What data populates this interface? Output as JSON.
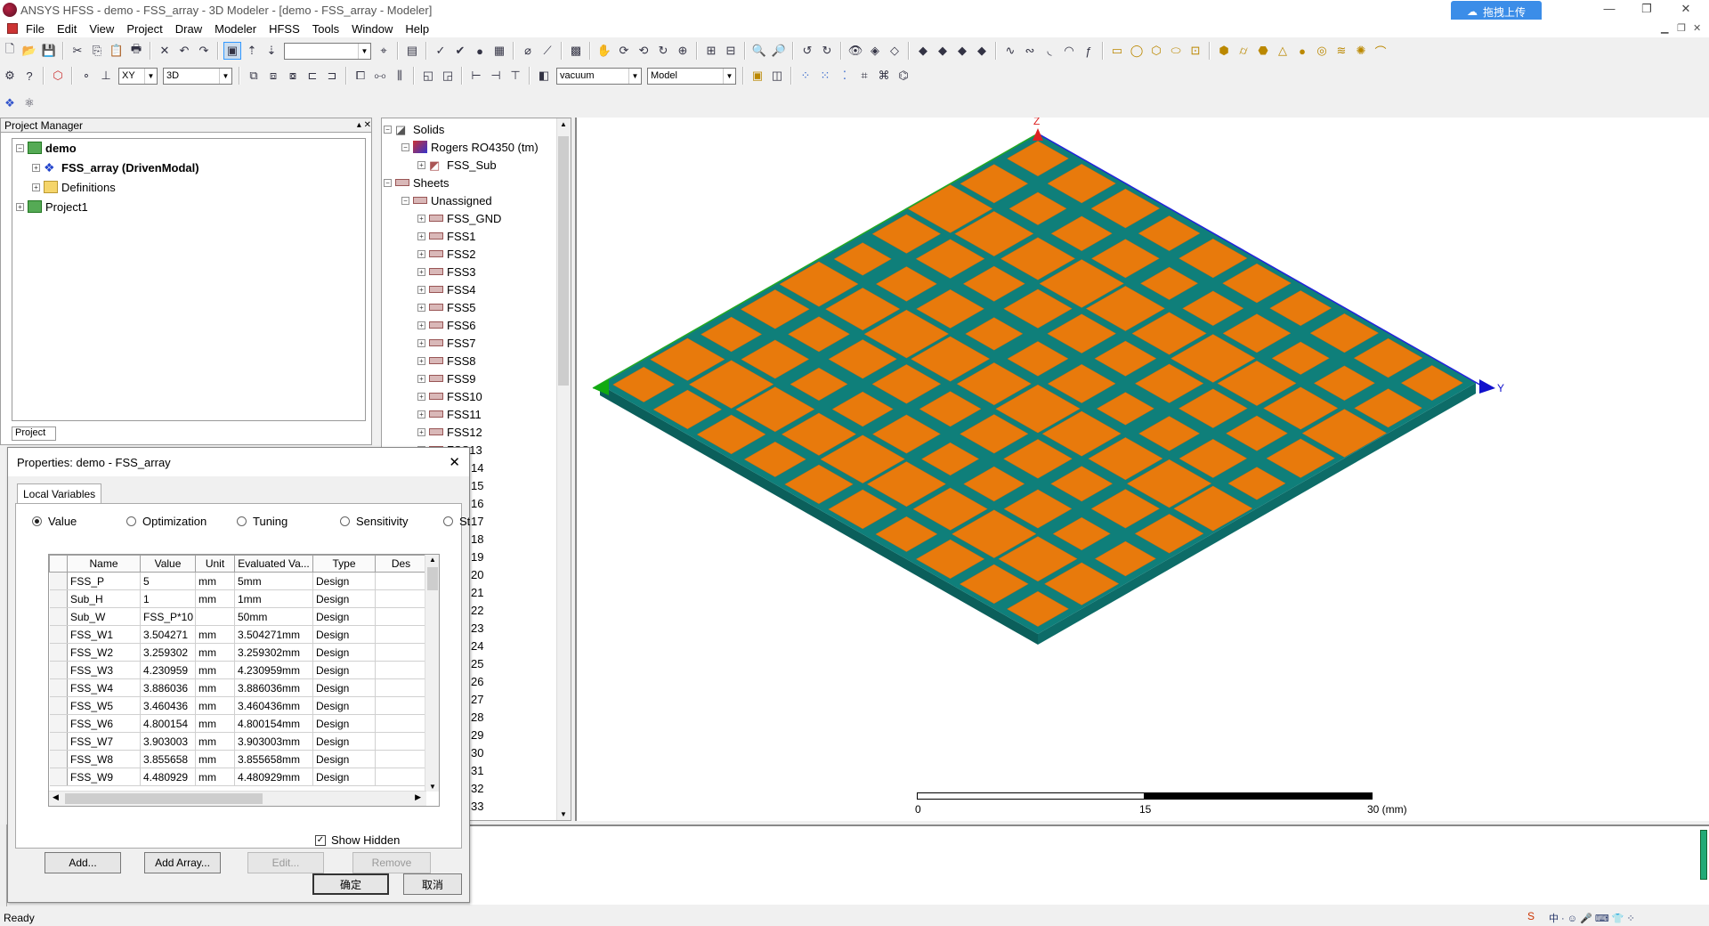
{
  "window": {
    "title": "ANSYS HFSS - demo - FSS_array - 3D Modeler - [demo - FSS_array - Modeler]",
    "cloud_button": "拖拽上传"
  },
  "menu": [
    "File",
    "Edit",
    "View",
    "Project",
    "Draw",
    "Modeler",
    "HFSS",
    "Tools",
    "Window",
    "Help"
  ],
  "toolbar": {
    "plane": "XY",
    "view": "3D",
    "material": "vacuum",
    "mode": "Model"
  },
  "project_manager": {
    "title": "Project Manager",
    "tab_stub": "Project",
    "items": [
      {
        "label": "demo",
        "bold": true
      },
      {
        "label": "FSS_array (DrivenModal)",
        "bold": true
      },
      {
        "label": "Definitions",
        "bold": false
      },
      {
        "label": "Project1",
        "bold": false
      }
    ]
  },
  "model_tree": {
    "solids_label": "Solids",
    "material": "Rogers RO4350 (tm)",
    "sub": "FSS_Sub",
    "sheets_label": "Sheets",
    "unassigned": "Unassigned",
    "sheets": [
      "FSS_GND",
      "FSS1",
      "FSS2",
      "FSS3",
      "FSS4",
      "FSS5",
      "FSS6",
      "FSS7",
      "FSS8",
      "FSS9",
      "FSS10",
      "FSS11",
      "FSS12",
      "FSS13"
    ],
    "hidden_fragments": [
      "14",
      "15",
      "16",
      "17",
      "18",
      "19",
      "20",
      "21",
      "22",
      "23",
      "24",
      "25",
      "26",
      "27",
      "28",
      "29",
      "30",
      "31",
      "32",
      "33"
    ]
  },
  "properties": {
    "title": "Properties: demo - FSS_array",
    "tab": "Local Variables",
    "radios": [
      "Value",
      "Optimization",
      "Tuning",
      "Sensitivity",
      "St"
    ],
    "columns": [
      "Name",
      "Value",
      "Unit",
      "Evaluated Va...",
      "Type",
      "Des"
    ],
    "rows": [
      [
        "FSS_P",
        "5",
        "mm",
        "5mm",
        "Design"
      ],
      [
        "Sub_H",
        "1",
        "mm",
        "1mm",
        "Design"
      ],
      [
        "Sub_W",
        "FSS_P*10",
        "",
        "50mm",
        "Design"
      ],
      [
        "FSS_W1",
        "3.504271",
        "mm",
        "3.504271mm",
        "Design"
      ],
      [
        "FSS_W2",
        "3.259302",
        "mm",
        "3.259302mm",
        "Design"
      ],
      [
        "FSS_W3",
        "4.230959",
        "mm",
        "4.230959mm",
        "Design"
      ],
      [
        "FSS_W4",
        "3.886036",
        "mm",
        "3.886036mm",
        "Design"
      ],
      [
        "FSS_W5",
        "3.460436",
        "mm",
        "3.460436mm",
        "Design"
      ],
      [
        "FSS_W6",
        "4.800154",
        "mm",
        "4.800154mm",
        "Design"
      ],
      [
        "FSS_W7",
        "3.903003",
        "mm",
        "3.903003mm",
        "Design"
      ],
      [
        "FSS_W8",
        "3.855658",
        "mm",
        "3.855658mm",
        "Design"
      ],
      [
        "FSS_W9",
        "4.480929",
        "mm",
        "4.480929mm",
        "Design"
      ]
    ],
    "show_hidden": "Show Hidden",
    "buttons": {
      "add": "Add...",
      "add_array": "Add Array...",
      "edit": "Edit...",
      "remove": "Remove",
      "ok": "确定",
      "cancel": "取消"
    }
  },
  "viewport": {
    "axis_z": "Z",
    "axis_y": "Y",
    "scale": {
      "s0": "0",
      "s1": "15",
      "s2": "30 (mm)"
    },
    "colors": {
      "patch": "#e87a0c",
      "substrate": "#0f7f7a",
      "side_dark": "#0b5f5b"
    }
  },
  "status": "Ready"
}
